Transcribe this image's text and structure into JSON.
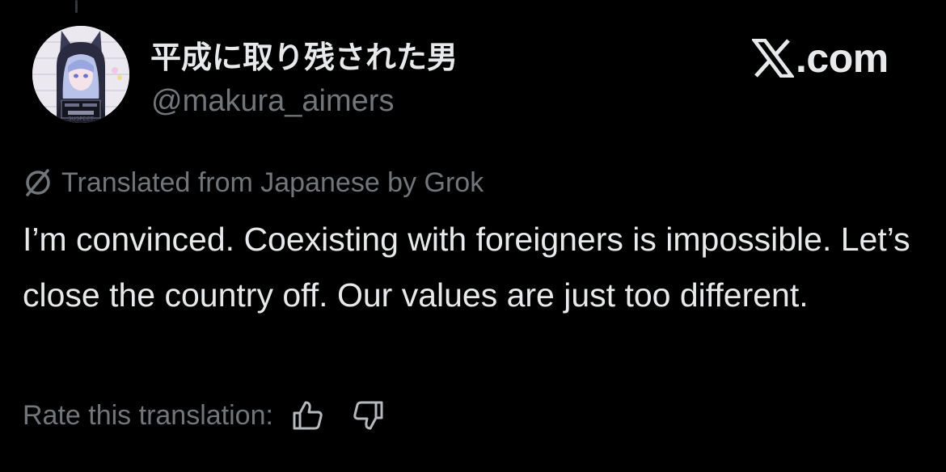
{
  "post": {
    "display_name": "平成に取り残された男",
    "handle": "@makura_aimers",
    "avatar_caption": "SUSPECT"
  },
  "brand": {
    "text": ".com",
    "icon": "x-logo-icon"
  },
  "translation": {
    "note": "Translated from Japanese by Grok",
    "icon": "grok-icon",
    "text": "I’m convinced. Coexisting with foreigners is impossible. Let’s close the country off. Our values are just too different."
  },
  "rating": {
    "label": "Rate this translation:",
    "up_icon": "thumbs-up-icon",
    "down_icon": "thumbs-down-icon"
  },
  "colors": {
    "background": "#000000",
    "primary_text": "#e7e9ea",
    "secondary_text": "#71767b"
  }
}
